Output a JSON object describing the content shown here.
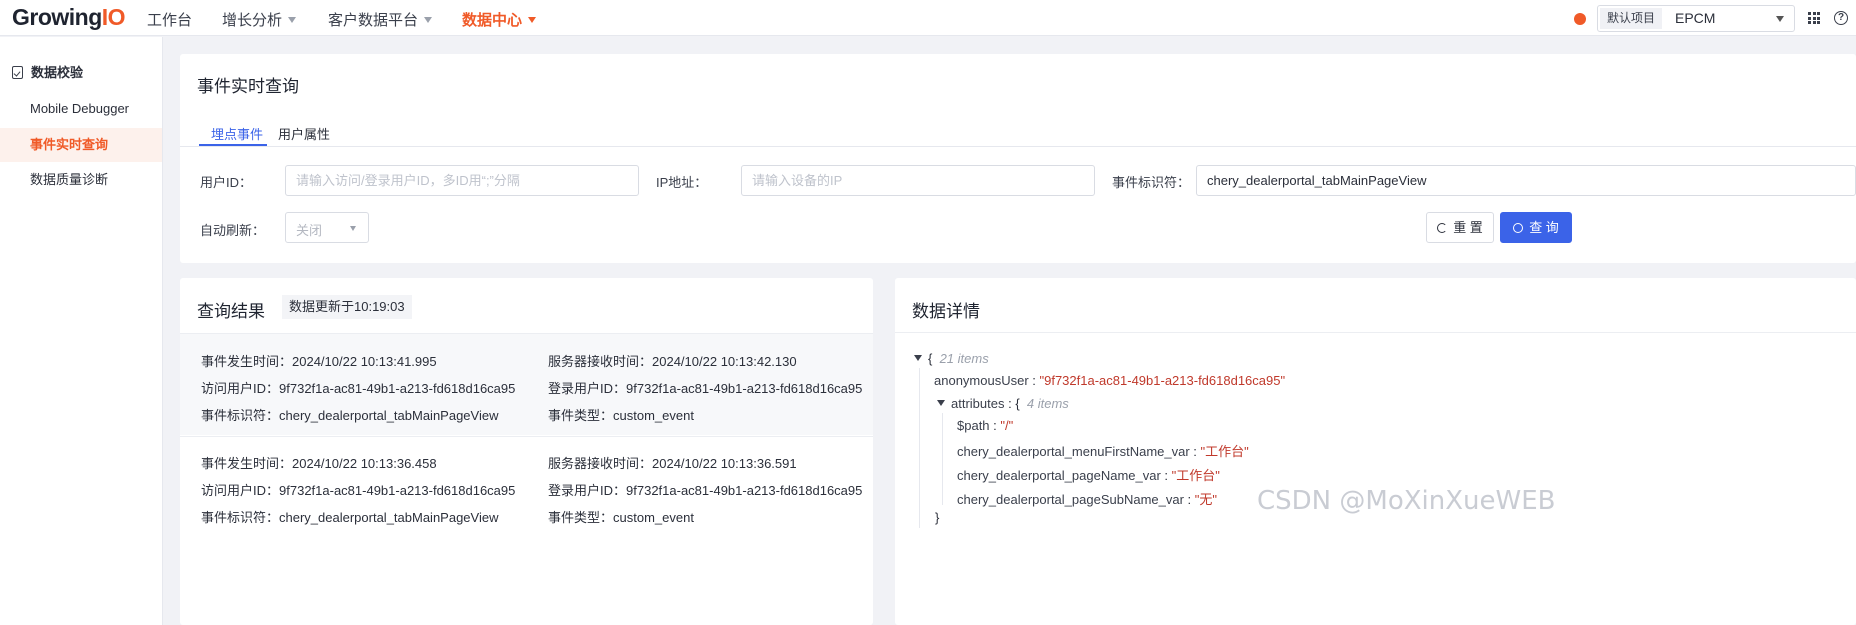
{
  "topnav": {
    "logo_main": "Growing",
    "logo_accent": "IO",
    "items": [
      {
        "label": "工作台",
        "has_caret": false
      },
      {
        "label": "增长分析",
        "has_caret": true
      },
      {
        "label": "客户数据平台",
        "has_caret": true
      },
      {
        "label": "数据中心",
        "has_caret": true,
        "active": true
      }
    ],
    "project_tag": "默认项目",
    "project_value": "EPCM"
  },
  "sidebar": {
    "group_label": "数据校验",
    "items": [
      {
        "label": "Mobile Debugger"
      },
      {
        "label": "事件实时查询",
        "active": true
      },
      {
        "label": "数据质量诊断"
      }
    ]
  },
  "query": {
    "title": "事件实时查询",
    "tabs": [
      {
        "label": "埋点事件",
        "active": true
      },
      {
        "label": "用户属性"
      }
    ],
    "user_id_label": "用户ID：",
    "user_id_placeholder": "请输入访问/登录用户ID，多ID用“;”分隔",
    "user_id_value": "",
    "ip_label": "IP地址：",
    "ip_placeholder": "请输入设备的IP",
    "ip_value": "",
    "event_key_label": "事件标识符：",
    "event_key_value": "chery_dealerportal_tabMainPageView",
    "auto_refresh_label": "自动刷新：",
    "auto_refresh_value": "关闭",
    "reset_label": "重 置",
    "query_label": "查 询"
  },
  "results": {
    "title": "查询结果",
    "updated_badge": "数据更新于10:19:03",
    "records": [
      {
        "event_time_label": "事件发生时间：",
        "event_time": "2024/10/22 10:13:41.995",
        "server_time_label": "服务器接收时间：",
        "server_time": "2024/10/22 10:13:42.130",
        "visitor_label": "访问用户ID：",
        "visitor_id": "9f732f1a-ac81-49b1-a213-fd618d16ca95",
        "login_label": "登录用户ID：",
        "login_id": "9f732f1a-ac81-49b1-a213-fd618d16ca95",
        "event_key_label": "事件标识符：",
        "event_key": "chery_dealerportal_tabMainPageView",
        "event_type_label": "事件类型：",
        "event_type": "custom_event"
      },
      {
        "event_time_label": "事件发生时间：",
        "event_time": "2024/10/22 10:13:36.458",
        "server_time_label": "服务器接收时间：",
        "server_time": "2024/10/22 10:13:36.591",
        "visitor_label": "访问用户ID：",
        "visitor_id": "9f732f1a-ac81-49b1-a213-fd618d16ca95",
        "login_label": "登录用户ID：",
        "login_id": "9f732f1a-ac81-49b1-a213-fd618d16ca95",
        "event_key_label": "事件标识符：",
        "event_key": "chery_dealerportal_tabMainPageView",
        "event_type_label": "事件类型：",
        "event_type": "custom_event"
      }
    ]
  },
  "detail": {
    "title": "数据详情",
    "root_brace": "{",
    "root_count": "21 items",
    "anonymous_key": "anonymousUser",
    "anonymous_value": "\"9f732f1a-ac81-49b1-a213-fd618d16ca95\"",
    "attributes_key": "attributes",
    "attributes_brace": "{",
    "attributes_count": "4 items",
    "attrs": [
      {
        "key": "$path",
        "value": "\"/\""
      },
      {
        "key": "chery_dealerportal_menuFirstName_var",
        "value": "\"工作台\""
      },
      {
        "key": "chery_dealerportal_pageName_var",
        "value": "\"工作台\""
      },
      {
        "key": "chery_dealerportal_pageSubName_var",
        "value": "\"无\""
      }
    ],
    "close_brace": "}",
    "separator": " : "
  },
  "watermark": "CSDN @MoXinXueWEB",
  "colors": {
    "accent": "#f05a28",
    "primary": "#3b63e8",
    "string_value": "#c0392b"
  }
}
